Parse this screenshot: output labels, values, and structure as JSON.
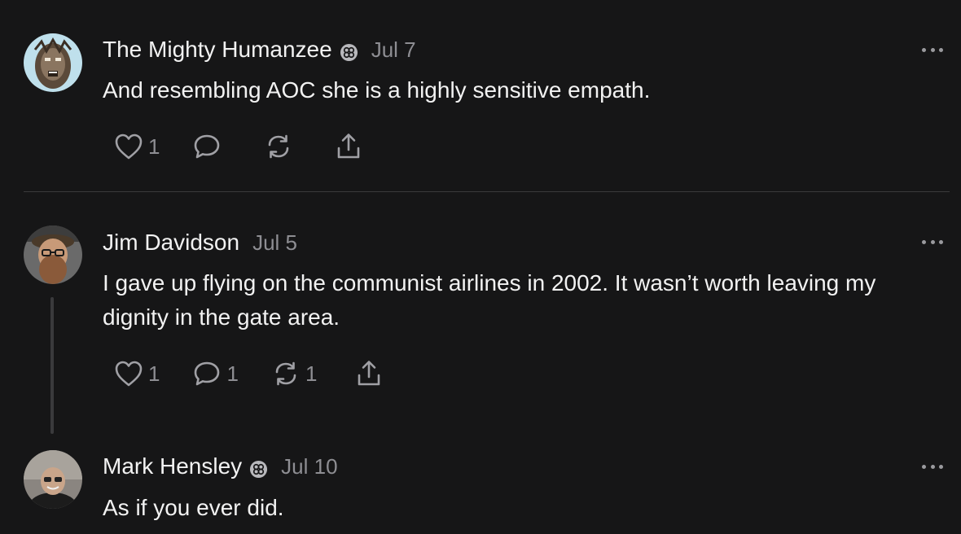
{
  "posts": [
    {
      "author": "The Mighty Humanzee",
      "date": "Jul 7",
      "text": "And resembling AOC she is a highly sensitive empath.",
      "likes": "1",
      "comments": "",
      "restacks": "",
      "has_badge": true
    },
    {
      "author": "Jim Davidson",
      "date": "Jul 5",
      "text": "I gave up flying on the communist airlines in 2002. It wasn’t worth leaving my dignity in the gate area.",
      "likes": "1",
      "comments": "1",
      "restacks": "1",
      "has_badge": false
    },
    {
      "author": "Mark Hensley",
      "date": "Jul 10",
      "text": "As if you ever did.",
      "has_badge": true
    }
  ],
  "colors": {
    "background": "#161617",
    "text": "#f2f2f2",
    "muted": "#8e8e93",
    "divider": "#3a3a3c"
  },
  "icons": [
    "heart-icon",
    "comment-icon",
    "restack-icon",
    "share-icon",
    "more-icon",
    "subscriber-badge-icon"
  ]
}
